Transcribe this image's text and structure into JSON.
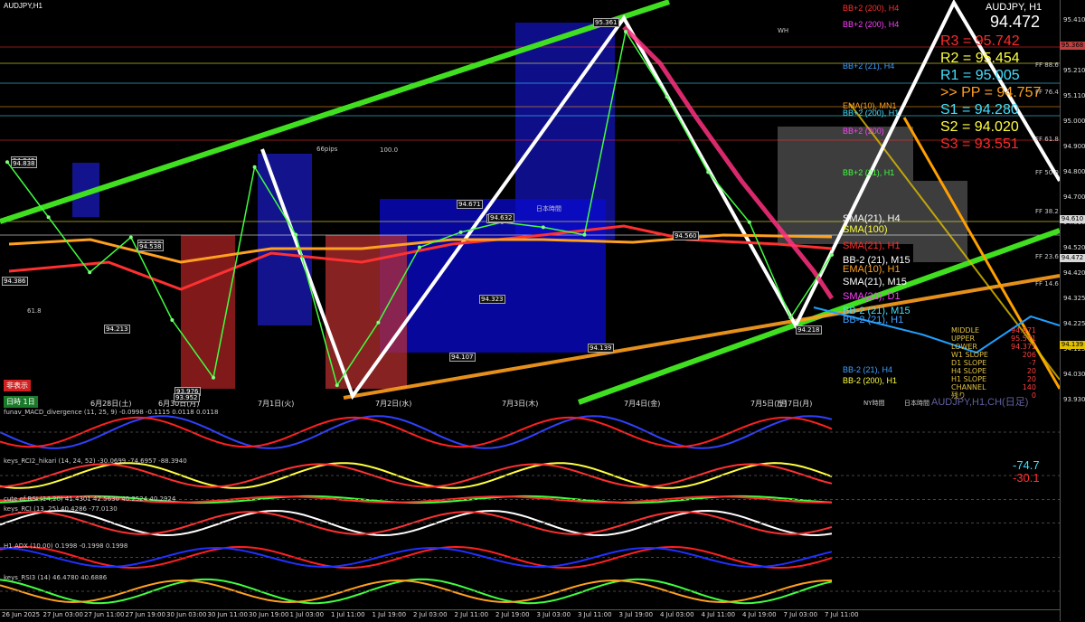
{
  "window": {
    "title": "AUDJPY,H1",
    "symbol_name": "AUDJPY, H1",
    "current_price": "94.472"
  },
  "main_pane": {
    "price_ticks": [
      "95.410",
      "95.310",
      "95.210",
      "95.110",
      "95.000",
      "94.900",
      "94.800",
      "94.700",
      "94.610",
      "94.520",
      "94.420",
      "94.325",
      "94.225",
      "94.125",
      "94.030",
      "93.930"
    ],
    "price_tags": [
      {
        "text": "95.368",
        "color": "#c04040"
      },
      {
        "text": "94.610",
        "color": "#d8d8d8"
      },
      {
        "text": "94.472",
        "color": "#d8d8d8"
      },
      {
        "text": "94.139",
        "color": "#e0c000"
      }
    ],
    "pivots": [
      {
        "label": "R3 = 95.742",
        "color": "#ff2a2a"
      },
      {
        "label": "R2 = 95.454",
        "color": "#ffff40"
      },
      {
        "label": "R1 = 95.005",
        "color": "#40e0ff"
      },
      {
        "label": ">> PP = 94.757",
        "color": "#ffa020"
      },
      {
        "label": "S1 = 94.280",
        "color": "#40e0ff"
      },
      {
        "label": "S2 = 94.020",
        "color": "#ffff40"
      },
      {
        "label": "S3 = 93.551",
        "color": "#ff2a2a"
      }
    ],
    "ma_labels": [
      {
        "text": "BB+2 (200), H4",
        "color": "#ff3030"
      },
      {
        "text": "BB+2 (200), H4",
        "color": "#ff40ff"
      },
      {
        "text": "BB+2 (21), H4",
        "color": "#40a0ff"
      },
      {
        "text": "EMA(10), MN1",
        "color": "#ffa020"
      },
      {
        "text": "BB+2 (200), H1",
        "color": "#40e0ff"
      },
      {
        "text": "BB+2 (200)",
        "color": "#ff40ff"
      },
      {
        "text": "BB+2 (21), H1",
        "color": "#40ff40"
      },
      {
        "text": "SMA(21), H4",
        "color": "#ffffff"
      },
      {
        "text": "SMA(100)",
        "color": "#ffff40"
      },
      {
        "text": "SMA(21), H1",
        "color": "#ff3030"
      },
      {
        "text": "BB-2 (21), M15",
        "color": "#ffffff"
      },
      {
        "text": "EMA(10), H1",
        "color": "#ffa020"
      },
      {
        "text": "SMA(21), M15",
        "color": "#ffffff"
      },
      {
        "text": "SMA(21), D1",
        "color": "#ff40ff"
      },
      {
        "text": "BB-2 (21), M15",
        "color": "#40e0ff"
      },
      {
        "text": "BB-2 (21), H1",
        "color": "#40a0ff"
      },
      {
        "text": "BB-2 (21), H4",
        "color": "#40a0ff"
      },
      {
        "text": "BB-2 (200), H1",
        "color": "#ffff40"
      }
    ],
    "channel_stats": [
      {
        "name": "MIDDLE",
        "value": "94.971"
      },
      {
        "name": "UPPER",
        "value": "95.571"
      },
      {
        "name": "LOWER",
        "value": "94.371"
      },
      {
        "name": "W1 SLOPE",
        "value": "206"
      },
      {
        "name": "D1 SLOPE",
        "value": "-7"
      },
      {
        "name": "H4 SLOPE",
        "value": "20"
      },
      {
        "name": "H1 SLOPE",
        "value": "20"
      },
      {
        "name": "CHANNEL",
        "value": "140"
      },
      {
        "name": "残り",
        "value": "0"
      }
    ],
    "price_boxes": [
      "94.842",
      "94.838",
      "94.586",
      "94.538",
      "94.386",
      "94.213",
      "93.976",
      "93.952",
      "94.553",
      "94.671",
      "94.632",
      "94.560",
      "94.323",
      "94.107",
      "94.139",
      "95.361",
      "94.218",
      "94.560"
    ],
    "misc_texts": [
      "66pips",
      "日本時間",
      "FF 88.6",
      "FF 76.4",
      "FF 61.8",
      "FF 50.0",
      "FF 38.2",
      "FF 23.6",
      "FF 14.6",
      "100.0",
      "61.8",
      "NY時間",
      "日本時間",
      "WH"
    ],
    "date_labels": [
      "6月28日(土)",
      "6月30日(月)",
      "7月1日(火)",
      "7月2日(水)",
      "7月3日(木)",
      "7月4日(金)",
      "7月5日(土)",
      "7月7日(月)"
    ],
    "buttons": {
      "hide": "非表示",
      "settings": "日時 1日"
    },
    "watermark": "AUDJPY,H1,CH(日足)"
  },
  "subpanes": [
    {
      "label": "funav_MACD_divergence (11, 25, 9) -0.0998 -0.1115 0.0118 0.0118",
      "ticks": [
        "0.1150",
        "0.00",
        "-0.0998",
        "-0.1154"
      ]
    },
    {
      "label": "keys_RCI2_hikari (14, 24, 52) -30.0699 -74.6957 -88.3940",
      "ticks": [
        "91.2937",
        "-74.7",
        "-30.1",
        "-99.0000"
      ],
      "big_values": [
        {
          "text": "-74.7",
          "color": "#40e0ff"
        },
        {
          "text": "-30.1",
          "color": "#ff3030"
        }
      ]
    },
    {
      "label": "cute of RSI (14,20) 41.4301 42.5630 40.2524 40.2924",
      "ticks": [
        "62.1511",
        "40.2924"
      ]
    },
    {
      "label": "keys_RCI (13, 25) 40.4286 -77.0130",
      "ticks": [
        "102.3450",
        "-77.0130",
        "-107.3450"
      ]
    },
    {
      "label": "H1 ADX (10.00) 0.1998 -0.1998 0.1998",
      "ticks": [
        "0.2554",
        "0.00",
        "-0.2554"
      ]
    },
    {
      "label": "keys_RSI3 (14) 46.4780 40.6886",
      "ticks": [
        "83.3482",
        "29.8699"
      ]
    }
  ],
  "time_labels": [
    "26 Jun 2025",
    "27 Jun 03:00",
    "27 Jun 11:00",
    "27 Jun 19:00",
    "30 Jun 03:00",
    "30 Jun 11:00",
    "30 Jun 19:00",
    "1 Jul 03:00",
    "1 Jul 11:00",
    "1 Jul 19:00",
    "2 Jul 03:00",
    "2 Jul 11:00",
    "2 Jul 19:00",
    "3 Jul 03:00",
    "3 Jul 11:00",
    "3 Jul 19:00",
    "4 Jul 03:00",
    "4 Jul 11:00",
    "4 Jul 19:00",
    "7 Jul 03:00",
    "7 Jul 11:00"
  ],
  "chart_data": {
    "type": "line",
    "title": "AUDJPY,H1",
    "x": [
      "26 Jun 2025",
      "27 Jun 03:00",
      "27 Jun 11:00",
      "27 Jun 19:00",
      "30 Jun 03:00",
      "30 Jun 11:00",
      "30 Jun 19:00",
      "1 Jul 03:00",
      "1 Jul 11:00",
      "1 Jul 19:00",
      "2 Jul 03:00",
      "2 Jul 11:00",
      "2 Jul 19:00",
      "3 Jul 03:00",
      "3 Jul 11:00",
      "3 Jul 19:00",
      "4 Jul 03:00",
      "4 Jul 11:00",
      "4 Jul 19:00",
      "7 Jul 03:00",
      "7 Jul 11:00"
    ],
    "series": [
      {
        "name": "AUDJPY,H1",
        "values": [
          94.84,
          94.62,
          94.4,
          94.54,
          94.21,
          93.98,
          94.82,
          94.55,
          93.95,
          94.2,
          94.5,
          94.56,
          94.6,
          94.58,
          94.55,
          95.36,
          95.1,
          94.8,
          94.6,
          94.22,
          94.47
        ]
      }
    ],
    "ylim": [
      93.9,
      95.45
    ],
    "pivot_levels": {
      "R3": 95.742,
      "R2": 95.454,
      "R1": 95.005,
      "PP": 94.757,
      "S1": 94.28,
      "S2": 94.02,
      "S3": 93.551
    }
  }
}
